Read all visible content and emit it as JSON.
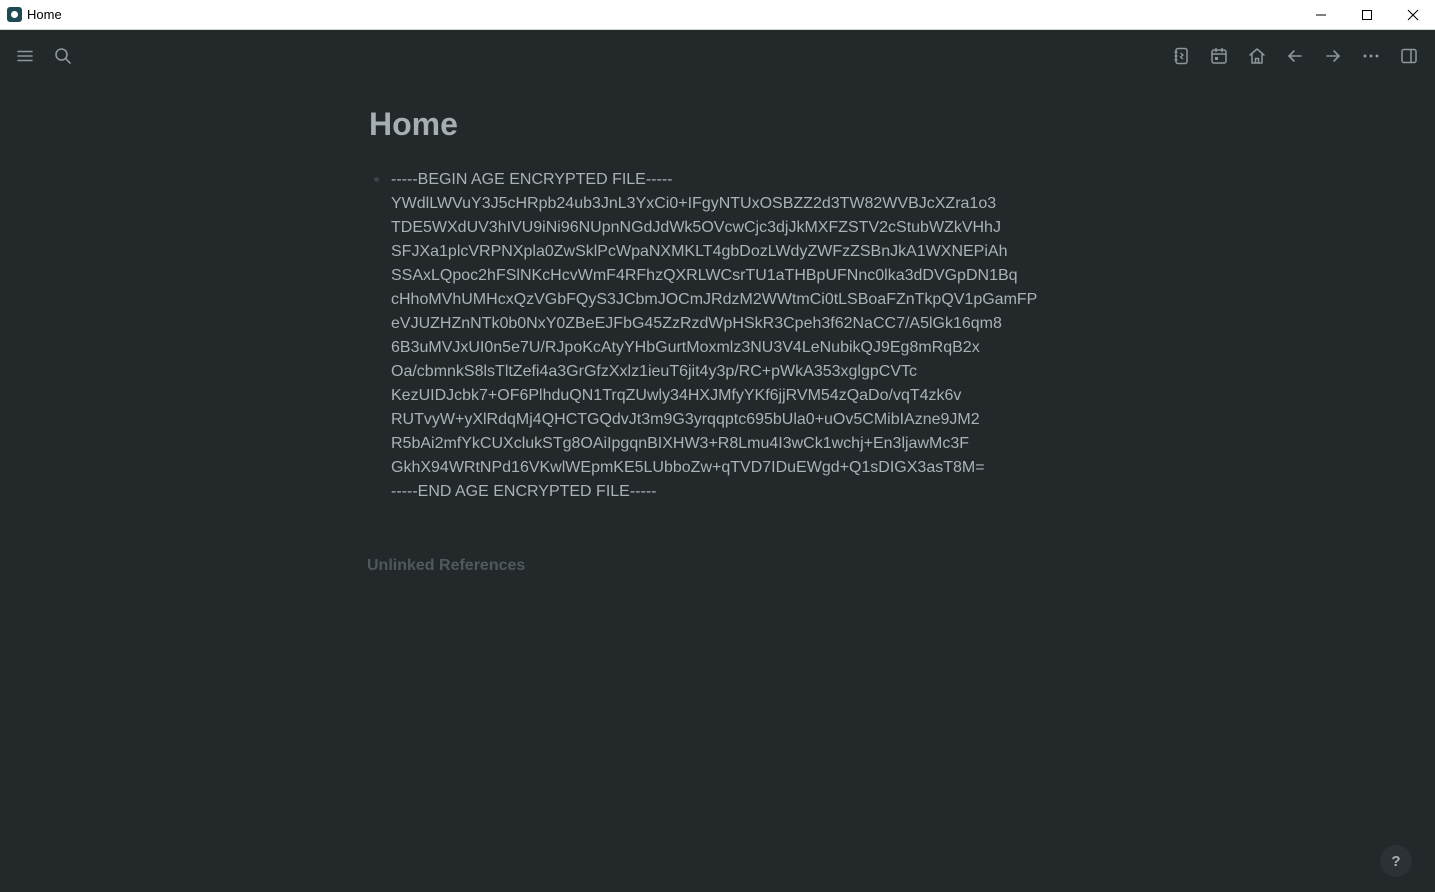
{
  "window": {
    "title": "Home"
  },
  "toolbar": {
    "left_icons": [
      "menu-icon",
      "search-icon"
    ],
    "right_icons": [
      "notebook-icon",
      "calendar-icon",
      "home-icon",
      "arrow-left-icon",
      "arrow-right-icon",
      "more-icon",
      "sidebar-toggle-icon"
    ]
  },
  "page": {
    "title": "Home",
    "block_lines": [
      "-----BEGIN AGE ENCRYPTED FILE-----",
      "YWdlLWVuY3J5cHRpb24ub3JnL3YxCi0+IFgyNTUxOSBZZ2d3TW82WVBJcXZra1o3",
      "TDE5WXdUV3hIVU9iNi96NUpnNGdJdWk5OVcwCjc3djJkMXFZSTV2cStubWZkVHhJ",
      "SFJXa1plcVRPNXpla0ZwSklPcWpaNXMKLT4gbDozLWdyZWFzZSBnJkA1WXNEPiAh",
      "SSAxLQpoc2hFSlNKcHcvWmF4RFhzQXRLWCsrTU1aTHBpUFNnc0lka3dDVGpDN1Bq",
      "cHhoMVhUMHcxQzVGbFQyS3JCbmJOCmJRdzM2WWtmCi0tLSBoaFZnTkpQV1pGamFP",
      "eVJUZHZnNTk0b0NxY0ZBeEJFbG45ZzRzdWpHSkR3Cpeh3f62NaCC7/A5lGk16qm8",
      "6B3uMVJxUI0n5e7U/RJpoKcAtyYHbGurtMoxmlz3NU3V4LeNubikQJ9Eg8mRqB2x",
      "Oa/cbmnkS8lsTltZefi4a3GrGfzXxlz1ieuT6jit4y3p/RC+pWkA353xglgpCVTc",
      "KezUIDJcbk7+OF6PlhduQN1TrqZUwly34HXJMfyYKf6jjRVM54zQaDo/vqT4zk6v",
      "RUTvyW+yXlRdqMj4QHCTGQdvJt3m9G3yrqqptc695bUla0+uOv5CMibIAzne9JM2",
      "R5bAi2mfYkCUXclukSTg8OAiIpgqnBIXHW3+R8Lmu4I3wCk1wchj+En3ljawMc3F",
      "GkhX94WRtNPd16VKwlWEpmKE5LUbboZw+qTVD7IDuEWgd+Q1sDIGX3asT8M=",
      "-----END AGE ENCRYPTED FILE-----"
    ],
    "unlinked_references": "Unlinked References"
  },
  "help": {
    "label": "?"
  }
}
